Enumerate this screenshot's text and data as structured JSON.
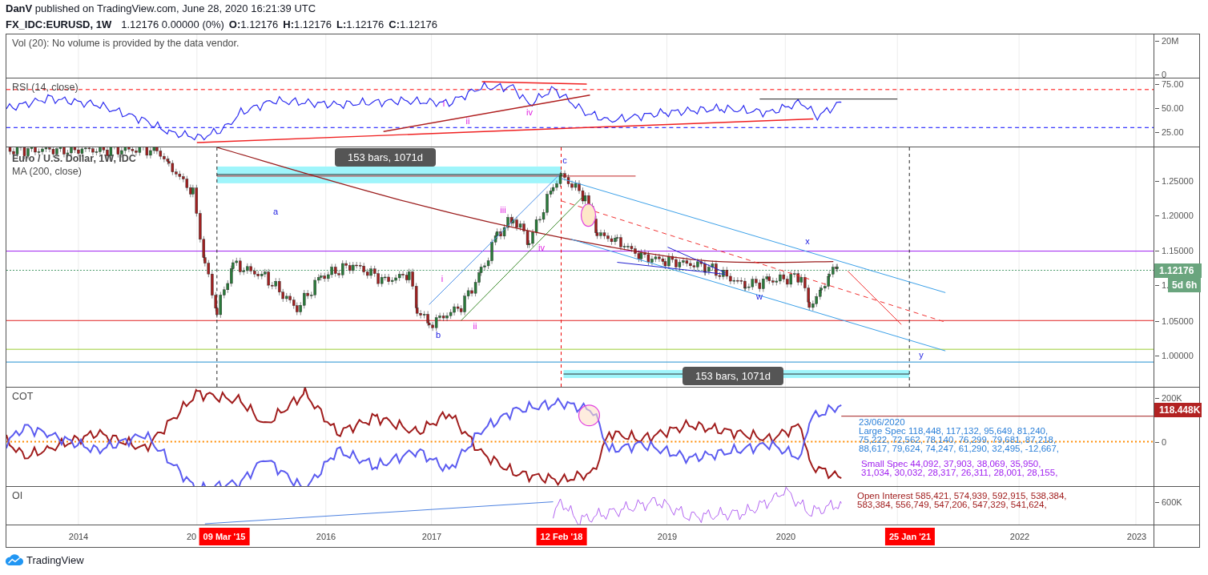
{
  "header": {
    "author": "DanV",
    "text": "published on TradingView.com, June 28, 2020 16:21:39 UTC"
  },
  "symbol_bar": {
    "symbol": "FX_IDC:EURUSD, 1W",
    "quote": "1.12176 0.00000 (0%)",
    "ohlc": [
      {
        "label": "O:",
        "value": "1.12176"
      },
      {
        "label": "H:",
        "value": "1.12176"
      },
      {
        "label": "L:",
        "value": "1.12176"
      },
      {
        "label": "C:",
        "value": "1.12176"
      }
    ]
  },
  "volume_pane": {
    "legend": "Vol (20): No volume is provided by the data vendor.",
    "axis_labels": [
      "20M",
      "0"
    ]
  },
  "rsi_pane": {
    "legend": "RSI (14, close)",
    "axis_labels": [
      "75.00",
      "50.00",
      "25.00"
    ],
    "wave_labels": [
      "i",
      "ii",
      "iv"
    ]
  },
  "price_pane": {
    "legends": [
      "Euro / U.S. Dollar, 1W, IDC",
      "MA (200, close)"
    ],
    "axis_labels": [
      "1.25000",
      "1.20000",
      "1.15000",
      "1.",
      "1.05000",
      "1.00000"
    ],
    "price_badge": "1.12176",
    "countdown_badge": "5d 6h",
    "range_badges": [
      "153 bars, 1071d",
      "153 bars, 1071d"
    ],
    "wave_labels": [
      {
        "text": "a",
        "kind": "corrective"
      },
      {
        "text": "c",
        "kind": "corrective"
      },
      {
        "text": "iii",
        "kind": "impulse"
      },
      {
        "text": "iv",
        "kind": "impulse"
      },
      {
        "text": "i",
        "kind": "impulse"
      },
      {
        "text": "ii",
        "kind": "impulse"
      },
      {
        "text": "b",
        "kind": "corrective"
      },
      {
        "text": "x",
        "kind": "corrective"
      },
      {
        "text": "w",
        "kind": "corrective"
      },
      {
        "text": "y",
        "kind": "corrective"
      }
    ]
  },
  "cot_pane": {
    "legend": "COT",
    "axis_labels": [
      "200K",
      "0"
    ],
    "value_badge": "118.448K",
    "date": "23/06/2020",
    "large_spec": [
      "Large Spec 118,448, 117,132, 95,649, 81,240,",
      "75,222, 72,562, 78,140, 76,299, 79,681, 87,218,",
      "88,617, 79,624, 74,247, 61,290, 32,495, -12,667,"
    ],
    "small_spec": [
      "Small Spec 44,092, 37,903, 38,069, 35,950,",
      "31,034, 30,032, 28,317, 26,311, 28,001, 28,155,"
    ]
  },
  "oi_pane": {
    "legend": "OI",
    "axis_labels": [
      "600K"
    ],
    "open_interest": [
      "Open Interest 585,421, 574,939, 592,915, 538,384,",
      "583,384, 556,749, 547,206, 547,329, 541,624,"
    ]
  },
  "time_axis": {
    "labels": [
      "2014",
      "20",
      "2016",
      "2017",
      "2019",
      "2020",
      "2022",
      "2023"
    ],
    "markers": [
      "09 Mar '15",
      "12 Feb '18",
      "25 Jan '21"
    ]
  },
  "footer": {
    "brand": "TradingView"
  }
}
